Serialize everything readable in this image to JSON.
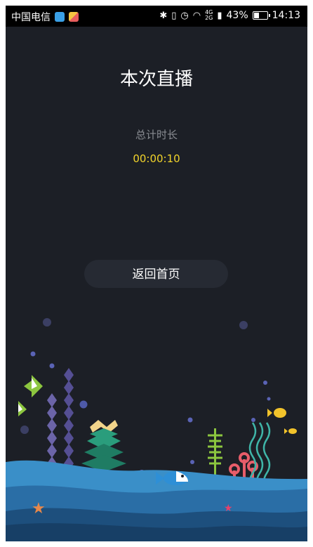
{
  "status_bar": {
    "carrier": "中国电信",
    "network_label_top": "4G",
    "network_label_bottom": "2G",
    "battery_percent": "43%",
    "battery_level": 0.43,
    "time": "14:13",
    "icons": [
      "bluetooth-icon",
      "vibrate-icon",
      "alarm-icon",
      "wifi-icon",
      "signal-icon",
      "battery-icon"
    ]
  },
  "page": {
    "title": "本次直播",
    "duration_label": "总计时长",
    "duration_value": "00:00:10",
    "home_button_label": "返回首页"
  },
  "colors": {
    "background": "#1c1f26",
    "accent_yellow": "#f2d42b",
    "button_bg": "#262a33",
    "wave_light": "#3a8fc8",
    "wave_mid": "#2a6ea6",
    "wave_dark": "#1d4f7d"
  }
}
